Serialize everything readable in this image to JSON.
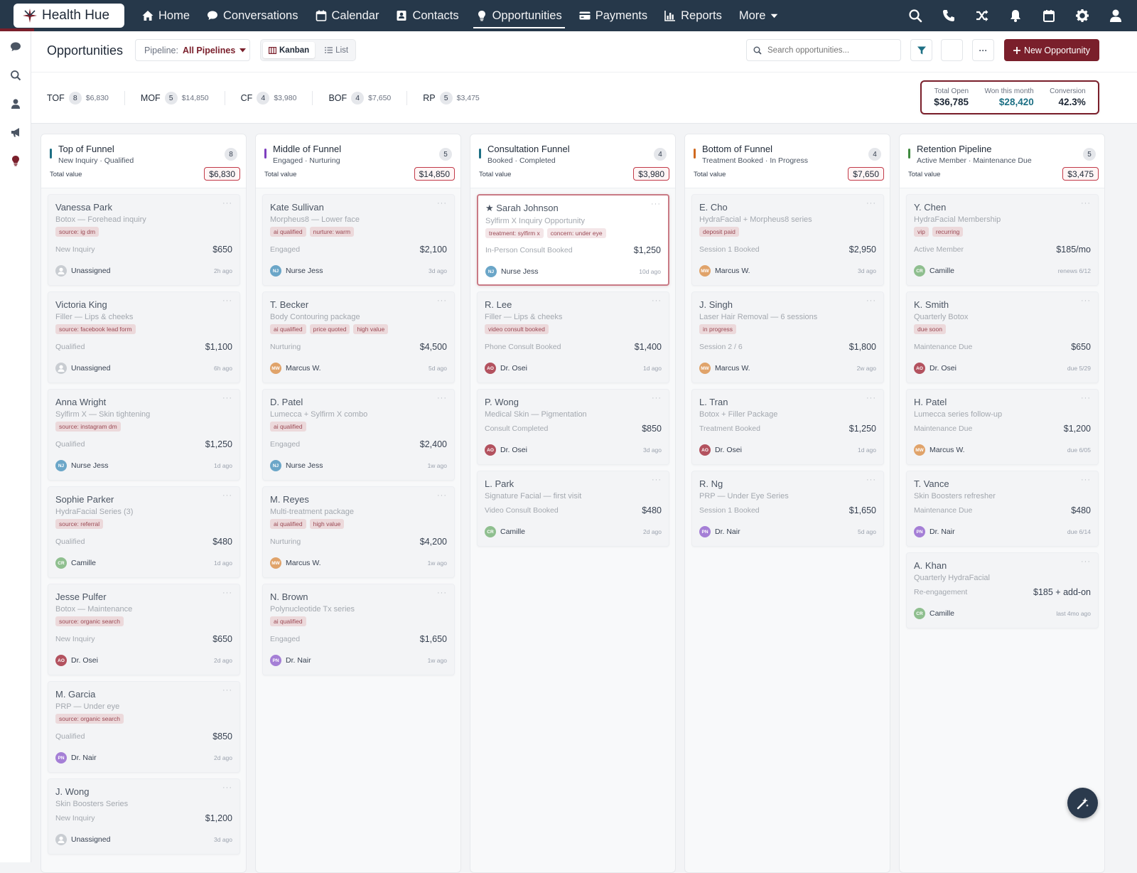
{
  "app": {
    "name": "Health Hue"
  },
  "nav": [
    {
      "label": "Home",
      "icon": "home-icon",
      "active": false
    },
    {
      "label": "Conversations",
      "icon": "chat-icon",
      "active": false
    },
    {
      "label": "Calendar",
      "icon": "calendar-icon",
      "active": false
    },
    {
      "label": "Contacts",
      "icon": "contacts-icon",
      "active": false
    },
    {
      "label": "Opportunities",
      "icon": "lightbulb-icon",
      "active": true
    },
    {
      "label": "Payments",
      "icon": "credit-card-icon",
      "active": false
    },
    {
      "label": "Reports",
      "icon": "bar-chart-icon",
      "active": false
    },
    {
      "label": "More",
      "icon": "chevron-down-icon",
      "active": false
    }
  ],
  "top_icons": [
    "search-icon",
    "phone-icon",
    "shuffle-icon",
    "bell-icon",
    "calendar-icon",
    "gear-icon",
    "user-icon"
  ],
  "left_icons": [
    "chat-icon",
    "search-icon",
    "user-icon",
    "megaphone-icon",
    "lightbulb-icon"
  ],
  "header": {
    "title": "Opportunities",
    "pipeline_label": "Pipeline:",
    "pipeline_value": "All Pipelines",
    "view_kanban": "Kanban",
    "view_list": "List",
    "search_placeholder": "Search opportunities...",
    "more_label": "···",
    "new_button": "New Opportunity"
  },
  "stages": [
    {
      "name": "TOF",
      "count": "8",
      "value": "$6,830"
    },
    {
      "name": "MOF",
      "count": "5",
      "value": "$14,850"
    },
    {
      "name": "CF",
      "count": "4",
      "value": "$3,980"
    },
    {
      "name": "BOF",
      "count": "4",
      "value": "$7,650"
    },
    {
      "name": "RP",
      "count": "5",
      "value": "$3,475"
    }
  ],
  "totals": [
    {
      "label": "Total Open",
      "value": "$36,785"
    },
    {
      "label": "Won this month",
      "value": "$28,420"
    },
    {
      "label": "Conversion",
      "value": "42.3%"
    }
  ],
  "colors": {
    "brand": "#7a1f2b",
    "nav_bg": "#26384a",
    "tof": "#1d6f84",
    "mof": "#7e3fbf",
    "cf": "#1d6f84",
    "bof": "#d0691f",
    "rp": "#3f8a3f"
  },
  "columns": [
    {
      "title": "Top of Funnel",
      "subtitle": "New Inquiry · Qualified",
      "count": "8",
      "total_label": "Total value",
      "total": "$6,830",
      "color": "#1d6f84",
      "cards": [
        {
          "name": "Vanessa Park",
          "service": "Botox — Forehead inquiry",
          "tags": [
            "source: ig dm"
          ],
          "status": "New Inquiry",
          "amount": "$650",
          "owner": "Unassigned",
          "initials": "",
          "time": "2h ago",
          "av": "#c9cdd2"
        },
        {
          "name": "Victoria King",
          "service": "Filler — Lips & cheeks",
          "tags": [
            "source: facebook lead form"
          ],
          "status": "Qualified",
          "amount": "$1,100",
          "owner": "Unassigned",
          "initials": "",
          "time": "6h ago",
          "av": "#c9cdd2"
        },
        {
          "name": "Anna Wright",
          "service": "Sylfirm X — Skin tightening",
          "tags": [
            "source: instagram dm"
          ],
          "status": "Qualified",
          "amount": "$1,250",
          "owner": "Nurse Jess",
          "initials": "NJ",
          "time": "1d ago",
          "av": "#6ba6c8"
        },
        {
          "name": "Sophie Parker",
          "service": "HydraFacial Series (3)",
          "tags": [
            "source: referral"
          ],
          "status": "Qualified",
          "amount": "$480",
          "owner": "Camille",
          "initials": "CR",
          "time": "1d ago",
          "av": "#8fbf8f"
        },
        {
          "name": "Jesse Pulfer",
          "service": "Botox — Maintenance",
          "tags": [
            "source: organic search"
          ],
          "status": "New Inquiry",
          "amount": "$650",
          "owner": "Dr. Osei",
          "initials": "AO",
          "time": "2d ago",
          "av": "#b3525f"
        },
        {
          "name": "M. Garcia",
          "service": "PRP — Under eye",
          "tags": [
            "source: organic search"
          ],
          "status": "Qualified",
          "amount": "$850",
          "owner": "Dr. Nair",
          "initials": "PN",
          "time": "2d ago",
          "av": "#a57fd6"
        },
        {
          "name": "J. Wong",
          "service": "Skin Boosters Series",
          "tags": [],
          "status": "New Inquiry",
          "amount": "$1,200",
          "owner": "Unassigned",
          "initials": "",
          "time": "3d ago",
          "av": "#c9cdd2"
        }
      ]
    },
    {
      "title": "Middle of Funnel",
      "subtitle": "Engaged · Nurturing",
      "count": "5",
      "total_label": "Total value",
      "total": "$14,850",
      "color": "#7e3fbf",
      "cards": [
        {
          "name": "Kate Sullivan",
          "service": "Morpheus8 — Lower face",
          "tags": [
            "ai qualified",
            "nurture: warm"
          ],
          "status": "Engaged",
          "amount": "$2,100",
          "owner": "Nurse Jess",
          "initials": "NJ",
          "time": "3d ago",
          "av": "#6ba6c8"
        },
        {
          "name": "T. Becker",
          "service": "Body Contouring package",
          "tags": [
            "ai qualified",
            "price quoted",
            "high value"
          ],
          "status": "Nurturing",
          "amount": "$4,500",
          "owner": "Marcus W.",
          "initials": "MW",
          "time": "5d ago",
          "av": "#e0a36a"
        },
        {
          "name": "D. Patel",
          "service": "Lumecca + Sylfirm X combo",
          "tags": [
            "ai qualified"
          ],
          "status": "Engaged",
          "amount": "$2,400",
          "owner": "Nurse Jess",
          "initials": "NJ",
          "time": "1w ago",
          "av": "#6ba6c8"
        },
        {
          "name": "M. Reyes",
          "service": "Multi-treatment package",
          "tags": [
            "ai qualified",
            "high value"
          ],
          "status": "Nurturing",
          "amount": "$4,200",
          "owner": "Marcus W.",
          "initials": "MW",
          "time": "1w ago",
          "av": "#e0a36a"
        },
        {
          "name": "N. Brown",
          "service": "Polynucleotide Tx series",
          "tags": [
            "ai qualified"
          ],
          "status": "Engaged",
          "amount": "$1,650",
          "owner": "Dr. Nair",
          "initials": "PN",
          "time": "1w ago",
          "av": "#a57fd6"
        }
      ]
    },
    {
      "title": "Consultation Funnel",
      "subtitle": "Booked · Completed",
      "count": "4",
      "total_label": "Total value",
      "total": "$3,980",
      "color": "#1d6f84",
      "cards": [
        {
          "name": "★ Sarah Johnson",
          "service": "Sylfirm X Inquiry Opportunity",
          "tags": [
            "treatment: sylfirm x",
            "concern: under eye"
          ],
          "status": "In-Person Consult Booked",
          "amount": "$1,250",
          "owner": "Nurse Jess",
          "initials": "NJ",
          "time": "10d ago",
          "av": "#6ba6c8",
          "highlight": true
        },
        {
          "name": "R. Lee",
          "service": "Filler — Lips & cheeks",
          "tags": [
            "video consult booked"
          ],
          "status": "Phone Consult Booked",
          "amount": "$1,400",
          "owner": "Dr. Osei",
          "initials": "AO",
          "time": "1d ago",
          "av": "#b3525f"
        },
        {
          "name": "P. Wong",
          "service": "Medical Skin — Pigmentation",
          "tags": [],
          "status": "Consult Completed",
          "amount": "$850",
          "owner": "Dr. Osei",
          "initials": "AO",
          "time": "3d ago",
          "av": "#b3525f"
        },
        {
          "name": "L. Park",
          "service": "Signature Facial — first visit",
          "tags": [],
          "status": "Video Consult Booked",
          "amount": "$480",
          "owner": "Camille",
          "initials": "CR",
          "time": "2d ago",
          "av": "#8fbf8f"
        }
      ]
    },
    {
      "title": "Bottom of Funnel",
      "subtitle": "Treatment Booked · In Progress",
      "count": "4",
      "total_label": "Total value",
      "total": "$7,650",
      "color": "#d0691f",
      "cards": [
        {
          "name": "E. Cho",
          "service": "HydraFacial + Morpheus8 series",
          "tags": [
            "deposit paid"
          ],
          "status": "Session 1 Booked",
          "amount": "$2,950",
          "owner": "Marcus W.",
          "initials": "MW",
          "time": "3d ago",
          "av": "#e0a36a"
        },
        {
          "name": "J. Singh",
          "service": "Laser Hair Removal — 6 sessions",
          "tags": [
            "in progress"
          ],
          "status": "Session 2 / 6",
          "amount": "$1,800",
          "owner": "Marcus W.",
          "initials": "MW",
          "time": "2w ago",
          "av": "#e0a36a"
        },
        {
          "name": "L. Tran",
          "service": "Botox + Filler Package",
          "tags": [],
          "status": "Treatment Booked",
          "amount": "$1,250",
          "owner": "Dr. Osei",
          "initials": "AO",
          "time": "1d ago",
          "av": "#b3525f"
        },
        {
          "name": "R. Ng",
          "service": "PRP — Under Eye Series",
          "tags": [],
          "status": "Session 1 Booked",
          "amount": "$1,650",
          "owner": "Dr. Nair",
          "initials": "PN",
          "time": "5d ago",
          "av": "#a57fd6"
        }
      ]
    },
    {
      "title": "Retention Pipeline",
      "subtitle": "Active Member · Maintenance Due",
      "count": "5",
      "total_label": "Total value",
      "total": "$3,475",
      "color": "#3f8a3f",
      "cards": [
        {
          "name": "Y. Chen",
          "service": "HydraFacial Membership",
          "tags": [
            "vip",
            "recurring"
          ],
          "status": "Active Member",
          "amount": "$185/mo",
          "owner": "Camille",
          "initials": "CR",
          "time": "renews 6/12",
          "av": "#8fbf8f"
        },
        {
          "name": "K. Smith",
          "service": "Quarterly Botox",
          "tags": [
            "due soon"
          ],
          "status": "Maintenance Due",
          "amount": "$650",
          "owner": "Dr. Osei",
          "initials": "AO",
          "time": "due 5/29",
          "av": "#b3525f"
        },
        {
          "name": "H. Patel",
          "service": "Lumecca series follow-up",
          "tags": [],
          "status": "Maintenance Due",
          "amount": "$1,200",
          "owner": "Marcus W.",
          "initials": "MW",
          "time": "due 6/05",
          "av": "#e0a36a"
        },
        {
          "name": "T. Vance",
          "service": "Skin Boosters refresher",
          "tags": [],
          "status": "Maintenance Due",
          "amount": "$480",
          "owner": "Dr. Nair",
          "initials": "PN",
          "time": "due 6/14",
          "av": "#a57fd6"
        },
        {
          "name": "A. Khan",
          "service": "Quarterly HydraFacial",
          "tags": [],
          "status": "Re-engagement",
          "amount": "$185 + add-on",
          "owner": "Camille",
          "initials": "CR",
          "time": "last 4mo ago",
          "av": "#8fbf8f"
        }
      ]
    }
  ]
}
